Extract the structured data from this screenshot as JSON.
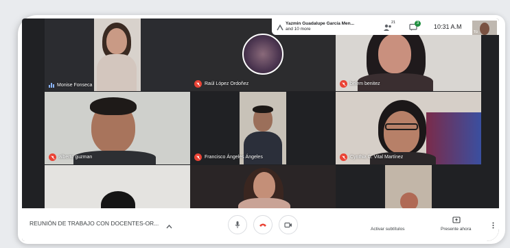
{
  "participants": [
    {
      "name": "Monise Fonseca",
      "status": "speaking"
    },
    {
      "name": "Raúl López Ordoñez",
      "status": "muted"
    },
    {
      "name": "belem benitez",
      "status": "muted"
    },
    {
      "name": "alberto guzman",
      "status": "muted"
    },
    {
      "name": "Francisco Ángeles Ángeles",
      "status": "muted"
    },
    {
      "name": "Cynthia C. Vital Martínez",
      "status": "muted"
    },
    {
      "name": "",
      "status": ""
    },
    {
      "name": "",
      "status": ""
    },
    {
      "name": "",
      "status": ""
    }
  ],
  "top_bar": {
    "presenter": "Yazmin Guadalupe García Men...",
    "others": "and 10 more",
    "people_count": "21",
    "chat_badge": "3",
    "time": "10:31 A.M",
    "self_label": "Tú"
  },
  "bottom_bar": {
    "meeting_title": "REUNIÓN DE TRABAJO CON DOCENTES-OR...",
    "captions_label": "Activar subtítulos",
    "present_label": "Presente ahora"
  },
  "colors": {
    "accent_red": "#ea4335",
    "bar_blue": "#8ab4f8",
    "badge_green": "#1e8e3e"
  }
}
